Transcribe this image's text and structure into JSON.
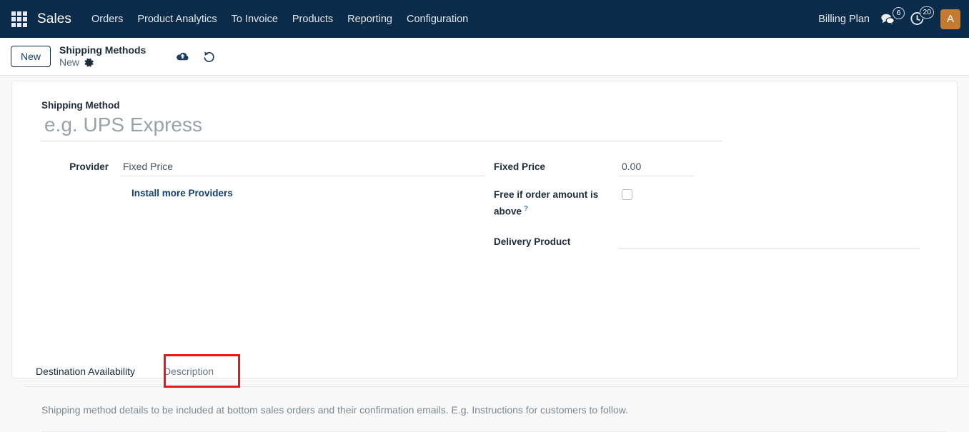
{
  "navbar": {
    "apps_icon": "apps-grid-icon",
    "brand": "Sales",
    "menu": [
      {
        "label": "Orders"
      },
      {
        "label": "Product Analytics"
      },
      {
        "label": "To Invoice"
      },
      {
        "label": "Products"
      },
      {
        "label": "Reporting"
      },
      {
        "label": "Configuration"
      }
    ],
    "billing_plan": "Billing Plan",
    "messages_icon": "chat-bubble-icon",
    "messages_count": "6",
    "activities_icon": "clock-activity-icon",
    "activities_count": "20",
    "avatar_initial": "A",
    "background_color": "#0b2b4a",
    "avatar_color": "#c47a30"
  },
  "control_bar": {
    "new_button": "New",
    "breadcrumb_parent": "Shipping Methods",
    "breadcrumb_current": "New",
    "gear_icon": "gear-icon",
    "save_icon": "cloud-upload-save-icon",
    "discard_icon": "undo-discard-icon"
  },
  "form": {
    "title_label": "Shipping Method",
    "title_placeholder": "e.g. UPS Express",
    "title_value": "",
    "left": {
      "provider_label": "Provider",
      "provider_value": "Fixed Price",
      "install_more_link": "Install more Providers"
    },
    "right": {
      "fixed_price_label": "Fixed Price",
      "fixed_price_value": "0.00",
      "free_if_above_label": "Free if order amount is above",
      "free_if_above_help": "?",
      "free_if_above_checked": false,
      "delivery_product_label": "Delivery Product",
      "delivery_product_value": ""
    }
  },
  "notebook": {
    "tabs": [
      {
        "label": "Destination Availability",
        "active": true
      },
      {
        "label": "Description",
        "active": false,
        "highlighted": true
      }
    ],
    "highlight_color": "#e8151a",
    "description_placeholder": "Shipping method details to be included at bottom sales orders and their confirmation emails. E.g. Instructions for customers to follow."
  }
}
